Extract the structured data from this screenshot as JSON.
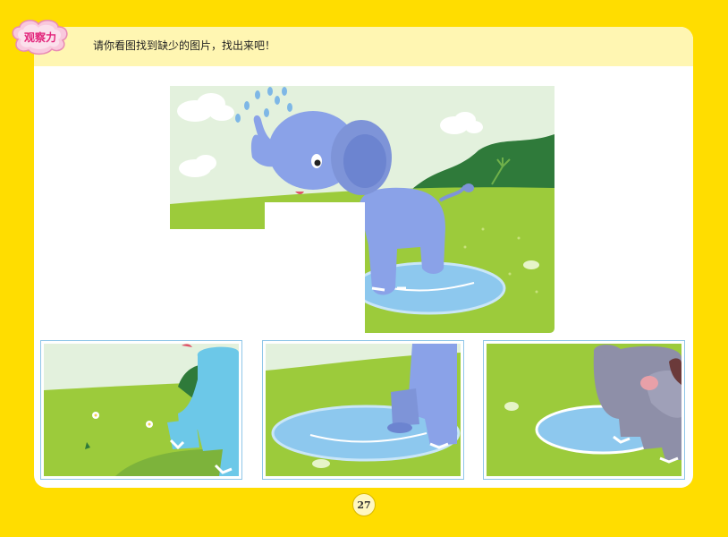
{
  "header": {
    "badge_label": "观察力",
    "instruction": "请你看图找到缺少的图片，找出来吧！"
  },
  "main_scene": {
    "missing_piece": "bottom-left"
  },
  "options": [
    {
      "id": "option-1",
      "content": "elephant-front-legs-with-flowers"
    },
    {
      "id": "option-2",
      "content": "elephant-foot-in-puddle"
    },
    {
      "id": "option-3",
      "content": "hippo-in-puddle"
    }
  ],
  "footer": {
    "page_number": "27"
  },
  "colors": {
    "page_bg": "#FFDD00",
    "header_band": "#FFF6B2",
    "badge_pink": "#E2237A",
    "grass": "#9CCB3B",
    "sky": "#E3F1DD",
    "elephant": "#8AA2E8",
    "puddle": "#8DC8EE",
    "option_border": "#8FC6E8"
  }
}
